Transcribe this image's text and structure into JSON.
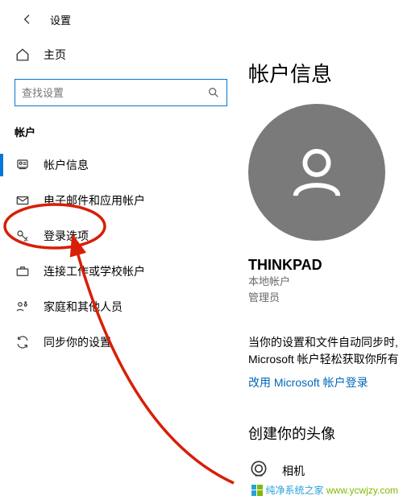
{
  "header": {
    "title": "设置"
  },
  "sidebar": {
    "home": "主页",
    "search_placeholder": "查找设置",
    "section": "帐户",
    "items": [
      {
        "key": "account-info",
        "label": "帐户信息",
        "active": true
      },
      {
        "key": "email-accounts",
        "label": "电子邮件和应用帐户",
        "active": false
      },
      {
        "key": "signin-options",
        "label": "登录选项",
        "active": false
      },
      {
        "key": "work-school",
        "label": "连接工作或学校帐户",
        "active": false
      },
      {
        "key": "family",
        "label": "家庭和其他人员",
        "active": false
      },
      {
        "key": "sync",
        "label": "同步你的设置",
        "active": false
      }
    ]
  },
  "content": {
    "title": "帐户信息",
    "account_name": "THINKPAD",
    "account_type": "本地帐户",
    "account_role": "管理员",
    "sync_message_line1": "当你的设置和文件自动同步时,",
    "sync_message_line2": "Microsoft 帐户轻松获取你所有",
    "signin_link": "改用 Microsoft 帐户登录",
    "avatar_title": "创建你的头像",
    "camera_label": "相机"
  },
  "watermark": {
    "brand": "纯净系统之家",
    "url": "www.ycwjzy.com"
  },
  "annotation": {
    "circle_color": "#d81e06",
    "arrow_color": "#d81e06"
  }
}
